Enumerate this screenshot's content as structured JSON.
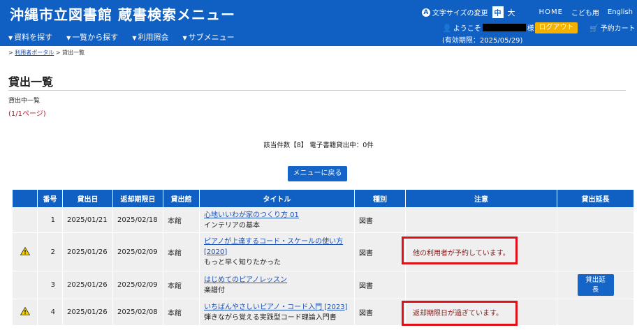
{
  "header": {
    "site_title": "沖縄市立図書館 蔵書検索メニュー",
    "nav": [
      {
        "label": "資料を探す"
      },
      {
        "label": "一覧から探す"
      },
      {
        "label": "利用照会"
      },
      {
        "label": "サブメニュー"
      }
    ],
    "font_size_label": "文字サイズの変更",
    "font_size_mid": "中",
    "font_size_large": "大",
    "home_link": "HOME",
    "kids_link": "こども用",
    "english_link": "English",
    "welcome_prefix": "ようこそ",
    "welcome_suffix": "様",
    "validity": "(有効期限：2025/05/29)",
    "logout_label": "ログアウト",
    "cart_label": "予約カート"
  },
  "breadcrumb": {
    "sep1": ">",
    "portal_link": "利用者ポータル",
    "sep2": ">",
    "current": "貸出一覧"
  },
  "main": {
    "page_title": "貸出一覧",
    "subtitle": "貸出中一覧",
    "page_info": "(1/1ページ)",
    "count_text": "該当件数【8】 電子書籍貸出中：0件",
    "back_button": "メニューに戻る"
  },
  "table": {
    "headers": [
      "番号",
      "貸出日",
      "返却期限日",
      "貸出館",
      "タイトル",
      "種別",
      "注意",
      "貸出延長"
    ],
    "rows": [
      {
        "no": "1",
        "lent": "2025/01/21",
        "due": "2025/02/18",
        "branch": "本館",
        "title": "心地いいわが家のつくり方 01",
        "subtitle": "インテリアの基本",
        "type": "図書",
        "note": "",
        "warning": false,
        "extend": ""
      },
      {
        "no": "2",
        "lent": "2025/01/26",
        "due": "2025/02/09",
        "branch": "本館",
        "title": "ピアノが上達するコード・スケールの使い方 [2020]",
        "subtitle": "もっと早く知りたかった",
        "type": "図書",
        "note": "他の利用者が予約しています。",
        "warning": true,
        "extend": ""
      },
      {
        "no": "3",
        "lent": "2025/01/26",
        "due": "2025/02/09",
        "branch": "本館",
        "title": "はじめてのピアノレッスン",
        "subtitle": "楽譜付",
        "type": "図書",
        "note": "",
        "warning": false,
        "extend": "貸出延長"
      },
      {
        "no": "4",
        "lent": "2025/01/26",
        "due": "2025/02/08",
        "branch": "本館",
        "title": "いちばんやさしいピアノ・コード入門 [2023]",
        "subtitle": "弾きながら覚える実践型コード理論入門書",
        "type": "図書",
        "note": "返却期限日が過ぎています。",
        "warning": true,
        "extend": ""
      }
    ]
  },
  "colors": {
    "brand": "#1060c4",
    "logout": "#f5b100",
    "highlight": "#e0101a",
    "page_info": "#c0102a"
  },
  "icons": {
    "warning": "warning-triangle-icon",
    "user": "user-icon",
    "cart": "cart-icon",
    "help": "info-circle-icon"
  }
}
